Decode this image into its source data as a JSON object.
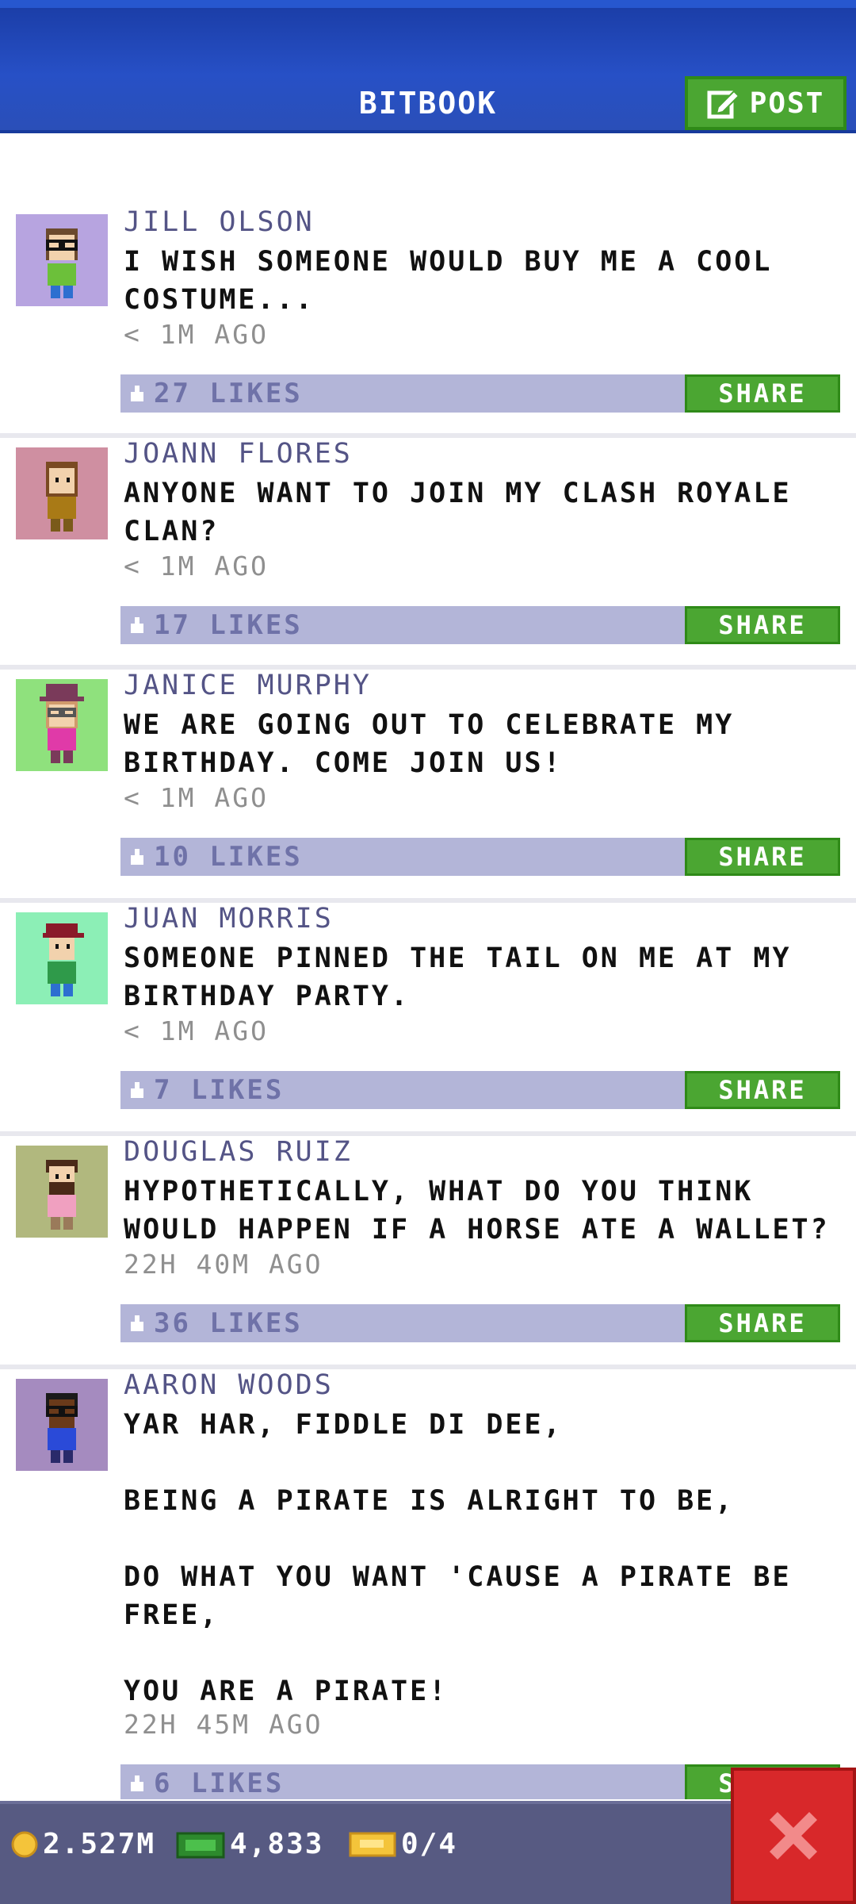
{
  "header": {
    "title": "BITBOOK",
    "post_label": "POST"
  },
  "posts": [
    {
      "name": "JILL OLSON",
      "text": "I WISH SOMEONE WOULD BUY ME A COOL\nCOSTUME...",
      "time": "< 1M AGO",
      "likes": "27 LIKES",
      "share": "SHARE",
      "avatar_bg": "#b7a4e0"
    },
    {
      "name": "JOANN FLORES",
      "text": "ANYONE WANT TO JOIN MY CLASH ROYALE\nCLAN?",
      "time": "< 1M AGO",
      "likes": "17 LIKES",
      "share": "SHARE",
      "avatar_bg": "#cf8fa1"
    },
    {
      "name": "JANICE MURPHY",
      "text": "WE ARE GOING OUT TO CELEBRATE MY\nBIRTHDAY. COME JOIN US!",
      "time": "< 1M AGO",
      "likes": "10 LIKES",
      "share": "SHARE",
      "avatar_bg": "#8fe17d"
    },
    {
      "name": "JUAN MORRIS",
      "text": "SOMEONE PINNED THE TAIL ON ME AT MY\nBIRTHDAY PARTY.",
      "time": "< 1M AGO",
      "likes": "7 LIKES",
      "share": "SHARE",
      "avatar_bg": "#8cefb6"
    },
    {
      "name": "DOUGLAS RUIZ",
      "text": "HYPOTHETICALLY, WHAT DO YOU THINK\nWOULD HAPPEN IF A HORSE ATE A WALLET?",
      "time": "22H 40M AGO",
      "likes": "36 LIKES",
      "share": "SHARE",
      "avatar_bg": "#b1b87e"
    },
    {
      "name": "AARON WOODS",
      "text": "YAR HAR, FIDDLE DI DEE,\n\nBEING A PIRATE IS ALRIGHT TO BE,\n\nDO WHAT YOU WANT 'CAUSE A PIRATE BE\nFREE,\n\nYOU ARE A PIRATE!",
      "time": "22H 45M AGO",
      "likes": "6 LIKES",
      "share": "SHARE",
      "avatar_bg": "#a58bbf"
    }
  ],
  "bottom_bar": {
    "coins": "2.527M",
    "bux": "4,833",
    "tickets": "0/4"
  },
  "colors": {
    "header_blue": "#2750c6",
    "share_green": "#4ba632",
    "like_bar": "#b3b5d8",
    "bottom_bar": "#575a82",
    "close_red": "#d8282a"
  },
  "icons": {
    "post": "edit-icon",
    "like": "thumb-up-icon",
    "coins": "coin-icon",
    "bux": "cash-icon",
    "tickets": "ticket-icon",
    "close": "close-icon"
  }
}
